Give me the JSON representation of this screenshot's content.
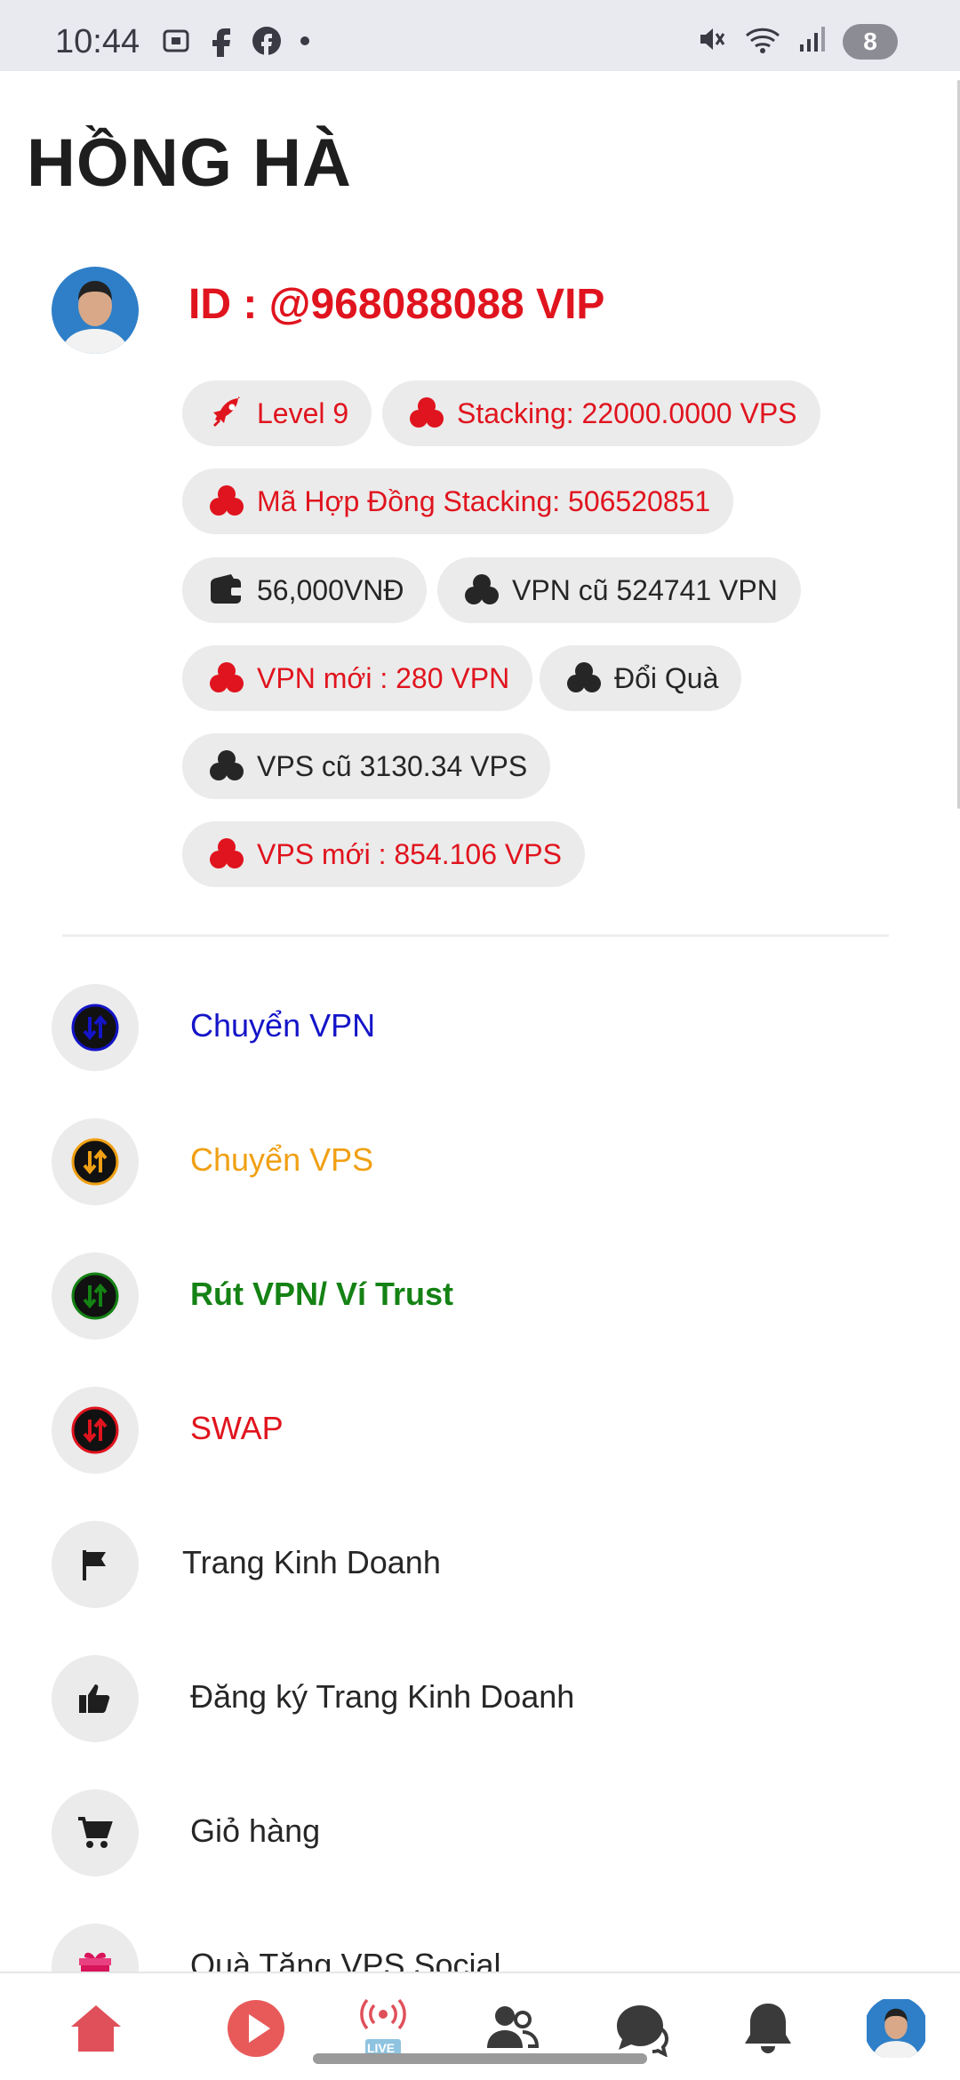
{
  "status_bar": {
    "time": "10:44",
    "battery": "8"
  },
  "page": {
    "title": "HỒNG HÀ"
  },
  "profile": {
    "id_text": "ID : @968088088 VIP",
    "chips": {
      "level": "Level 9",
      "stacking": "Stacking: 22000.0000 VPS",
      "contract": "Mã Hợp Đồng Stacking: 506520851",
      "wallet": "56,000VNĐ",
      "vpn_old": "VPN cũ 524741 VPN",
      "vpn_new": "VPN mới : 280 VPN",
      "gift": "Đổi Quà",
      "vps_old": "VPS cũ 3130.34 VPS",
      "vps_new": "VPS mới : 854.106 VPS"
    }
  },
  "menu": {
    "transfer_vpn": "Chuyển VPN",
    "transfer_vps": "Chuyển VPS",
    "withdraw_vpn": "Rút VPN/ Ví Trust",
    "swap": "SWAP",
    "business_page": "Trang Kinh Doanh",
    "register_business_page": "Đăng ký Trang Kinh Doanh",
    "cart": "Giỏ hàng",
    "gift_vps_social": "Quà Tặng VPS Social"
  },
  "bottom_nav": {
    "live_badge": "LIVE"
  },
  "colors": {
    "red": "#e0141e",
    "blue": "#1414c8",
    "orange": "#f0a014",
    "green": "#148214",
    "dark": "#262626"
  }
}
